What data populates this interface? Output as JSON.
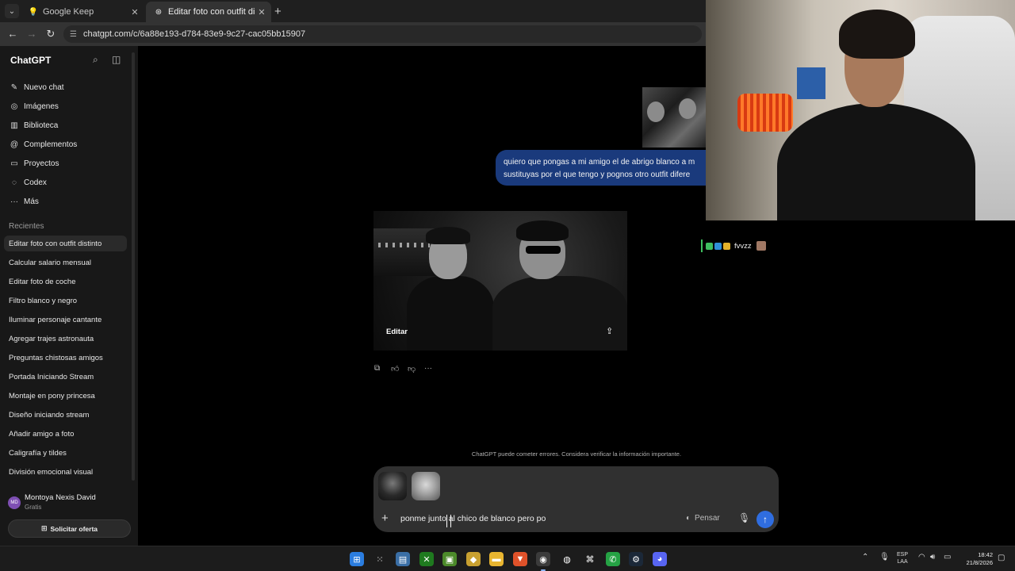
{
  "browser": {
    "tabs": [
      {
        "title": "Google Keep",
        "icon": "keep-icon"
      },
      {
        "title": "Editar foto con outfit distinto",
        "icon": "chatgpt-icon"
      }
    ],
    "url": "chatgpt.com/c/6a88e193-d784-83e9-9c27-cac05bb15907"
  },
  "sidebar": {
    "brand": "ChatGPT",
    "nav": [
      {
        "label": "Nuevo chat",
        "icon": "edit-icon"
      },
      {
        "label": "Imágenes",
        "icon": "images-icon"
      },
      {
        "label": "Biblioteca",
        "icon": "library-icon"
      },
      {
        "label": "Complementos",
        "icon": "plugins-icon"
      },
      {
        "label": "Proyectos",
        "icon": "folder-icon"
      },
      {
        "label": "Codex",
        "icon": "codex-icon"
      },
      {
        "label": "Más",
        "icon": "more-icon"
      }
    ],
    "recents_label": "Recientes",
    "recents": [
      "Editar foto con outfit distinto",
      "Calcular salario mensual",
      "Editar foto de coche",
      "Filtro blanco y negro",
      "Iluminar personaje cantante",
      "Agregar trajes astronauta",
      "Preguntas chistosas amigos",
      "Portada Iniciando Stream",
      "Montaje en pony princesa",
      "Diseño iniciando stream",
      "Añadir amigo a foto",
      "Caligrafía y tildes",
      "División emocional visual"
    ],
    "user": {
      "initials": "MD",
      "name": "Montoya Nexis David",
      "plan": "Gratis"
    },
    "offer_label": "Solicitar oferta"
  },
  "chat": {
    "user_message_line1": "quiero que pongas a mi amigo el de abrigo blanco a m",
    "user_message_line2": "sustituyas por el que tengo y pognos otro outfit difere",
    "image_edit_label": "Editar",
    "disclaimer": "ChatGPT puede cometer errores. Considera verificar la información importante."
  },
  "composer": {
    "input_text": "ponme junto al chico de blanco pero po",
    "think_label": "Pensar"
  },
  "overlay": {
    "stream_user": "fvvzz"
  },
  "taskbar": {
    "lang_line1": "ESP",
    "lang_line2": "LAA",
    "time": "18:42",
    "date": "21/8/2026"
  },
  "colors": {
    "accent_send": "#2f6de0",
    "user_bubble": "#1a3a7c",
    "sidebar_bg": "#181818"
  }
}
